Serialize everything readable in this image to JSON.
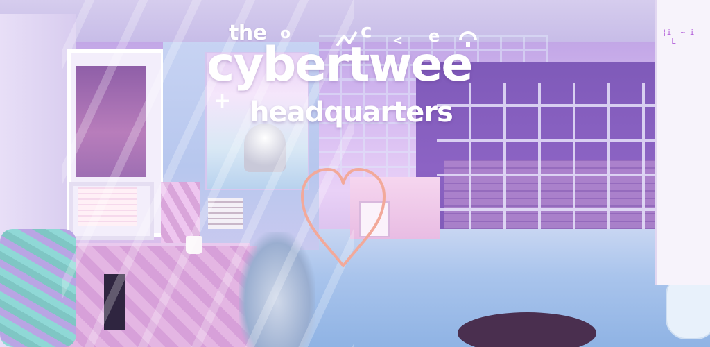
{
  "title": {
    "line1": "the",
    "main": "cybertwee",
    "sub": "headquarters"
  },
  "decorations": {
    "o": "o",
    "c": "c",
    "lt": "<",
    "e": "e",
    "plus": "+"
  },
  "right_panel_text": "¦i  ~ i\n  L",
  "colors": {
    "heart": "#f2a99a",
    "title": "#ffffff",
    "scene_purple": "#c9a8e6"
  },
  "icons": {
    "heart": "heart-icon"
  }
}
